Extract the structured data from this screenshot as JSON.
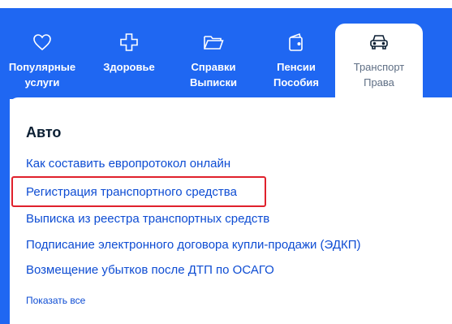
{
  "nav": {
    "tabs": [
      {
        "icon": "heart-icon",
        "line1": "Популярные",
        "line2": "услуги"
      },
      {
        "icon": "health-cross-icon",
        "line1": "Здоровье",
        "line2": ""
      },
      {
        "icon": "folder-icon",
        "line1": "Справки",
        "line2": "Выписки"
      },
      {
        "icon": "wallet-icon",
        "line1": "Пенсии",
        "line2": "Пособия"
      },
      {
        "icon": "car-icon",
        "line1": "Транспорт",
        "line2": "Права"
      }
    ],
    "active_tab": "Транспорт"
  },
  "section": {
    "title": "Авто",
    "links": [
      "Как составить европротокол онлайн",
      "Регистрация транспортного средства",
      "Выписка из реестра транспортных средств",
      "Подписание электронного договора купли-продажи (ЭДКП)",
      "Возмещение убытков после ДТП по ОСАГО"
    ],
    "show_all": "Показать все"
  },
  "colors": {
    "brand_blue": "#1f67f2",
    "link_blue": "#0d4cd3",
    "highlight_red": "#e0212c",
    "inactive_tab_text": "#5f6f85"
  }
}
